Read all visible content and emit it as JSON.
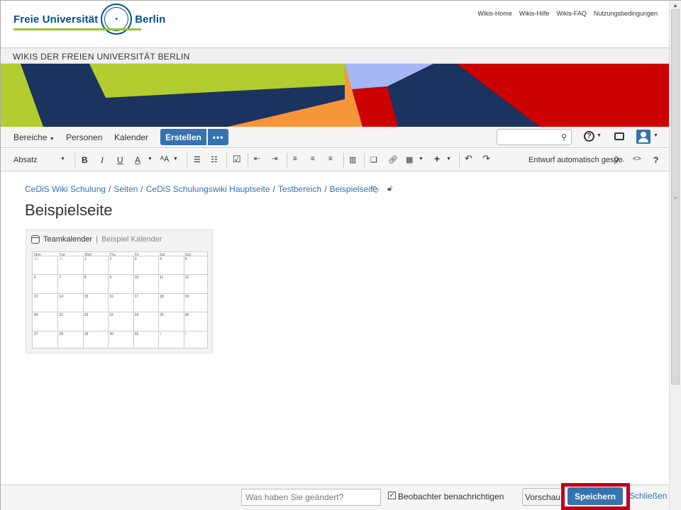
{
  "header": {
    "logo_left": "Freie Universität",
    "logo_right": "Berlin",
    "links": [
      "Wikis-Home",
      "Wikis-Hilfe",
      "Wikis-FAQ",
      "Nutzungsbedingungen"
    ]
  },
  "wikis_bar": {
    "title": "WIKIS DER FREIEN UNIVERSITÄT BERLIN"
  },
  "nav": {
    "spaces": "Bereiche",
    "people": "Personen",
    "calendar": "Kalender",
    "create": "Erstellen",
    "more": "•••",
    "help": "?"
  },
  "toolbar": {
    "paragraph": "Absatz",
    "bold": "B",
    "italic": "I",
    "underline": "U",
    "color": "A",
    "format": "A",
    "autosave": "Entwurf automatisch gespe",
    "source": "<>",
    "help": "?"
  },
  "breadcrumb": [
    "CeDiS Wiki Schulung",
    "Seiten",
    "CeDiS Schulungswiki Hauptseite",
    "Testbereich",
    "Beispielseite"
  ],
  "page": {
    "title": "Beispielseite"
  },
  "calendar": {
    "name": "Teamkalender",
    "separator": "|",
    "subtitle": "Beispiel Kalender",
    "days": [
      "Mon",
      "Tue",
      "Wed",
      "Thu",
      "Fri",
      "Sat",
      "Sun"
    ],
    "weeks": [
      [
        "30",
        "31",
        "1",
        "2",
        "3",
        "4",
        "5"
      ],
      [
        "6",
        "7",
        "8",
        "9",
        "10",
        "11",
        "12"
      ],
      [
        "13",
        "14",
        "15",
        "16",
        "17",
        "18",
        "19"
      ],
      [
        "20",
        "21",
        "22",
        "23",
        "24",
        "25",
        "26"
      ],
      [
        "27",
        "28",
        "29",
        "30",
        "31",
        "1",
        "2"
      ]
    ],
    "muted_cells": [
      "0-0",
      "0-1",
      "4-5",
      "4-6"
    ]
  },
  "bottom": {
    "change_placeholder": "Was haben Sie geändert?",
    "notify_label": "Beobachter benachrichtigen",
    "notify_checked": true,
    "preview": "Vorschau",
    "save": "Speichern",
    "close": "Schließen"
  },
  "colors": {
    "brand_blue": "#004f8f",
    "button_blue": "#3572b0",
    "highlight_red": "#c00018",
    "banner_navy": "#1b335f",
    "banner_green": "#b3cc2f",
    "banner_orange": "#f7953a",
    "banner_red": "#cc0000",
    "banner_lightblue": "#a5b8f5"
  }
}
